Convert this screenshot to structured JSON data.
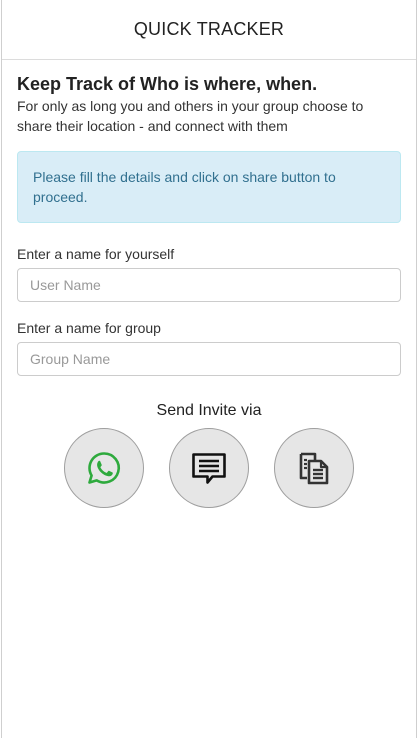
{
  "app": {
    "title": "QUICK TRACKER"
  },
  "intro": {
    "headline": "Keep Track of Who is where, when.",
    "subtext": "For only as long you and others in your group choose to share their location - and connect with them"
  },
  "alert": {
    "message": "Please fill the details and click on share button to proceed."
  },
  "form": {
    "user_label": "Enter a name for yourself",
    "user_placeholder": "User Name",
    "user_value": "",
    "group_label": "Enter a name for group",
    "group_placeholder": "Group Name",
    "group_value": ""
  },
  "invite": {
    "title": "Send Invite via",
    "options": [
      {
        "icon": "whatsapp-icon",
        "color": "#2eaa3d"
      },
      {
        "icon": "message-icon",
        "color": "#111111"
      },
      {
        "icon": "copy-icon",
        "color": "#333333"
      }
    ]
  },
  "colors": {
    "alert_bg": "#d9edf7",
    "alert_text": "#31708f",
    "button_bg": "#e6e6e6",
    "whatsapp_green": "#2eaa3d"
  }
}
